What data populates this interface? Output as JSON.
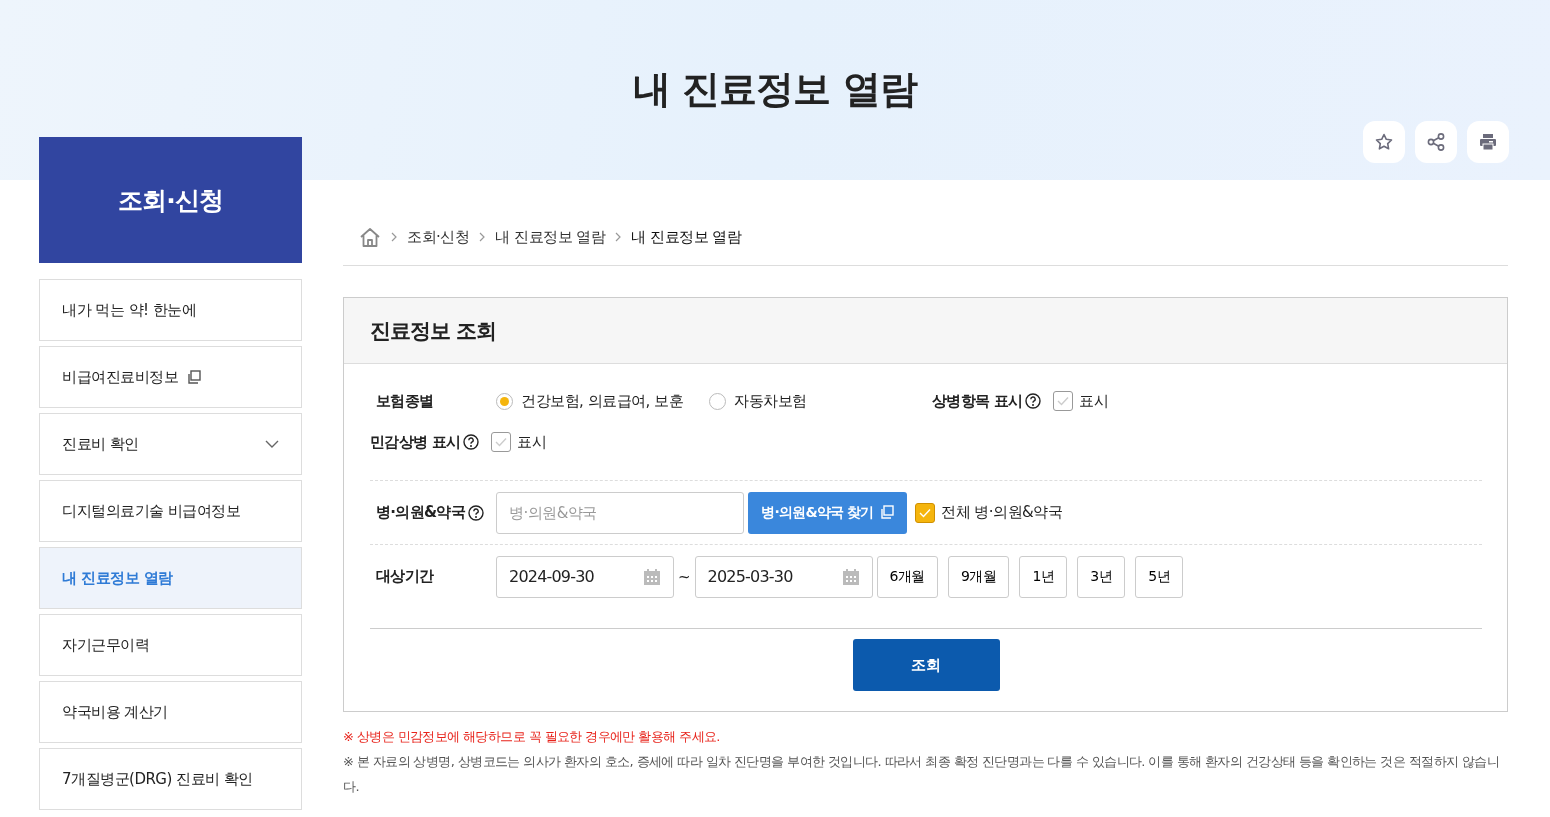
{
  "page_title": "내 진료정보 열람",
  "header_actions": [
    {
      "kind": "star"
    },
    {
      "kind": "share"
    },
    {
      "kind": "print"
    }
  ],
  "sidebar": {
    "title": "조회·신청",
    "items": [
      {
        "label": "내가 먹는 약! 한눈에",
        "kind": "plain",
        "selected": false
      },
      {
        "label": "비급여진료비정보",
        "kind": "external",
        "selected": false
      },
      {
        "label": "진료비 확인",
        "kind": "submenu",
        "selected": false
      },
      {
        "label": "디지털의료기술 비급여정보",
        "kind": "plain",
        "selected": false
      },
      {
        "label": "내 진료정보 열람",
        "kind": "plain",
        "selected": true
      },
      {
        "label": "자기근무이력",
        "kind": "plain",
        "selected": false
      },
      {
        "label": "약국비용 계산기",
        "kind": "plain",
        "selected": false
      },
      {
        "label": "7개질병군(DRG) 진료비 확인",
        "kind": "plain",
        "selected": false
      }
    ]
  },
  "breadcrumb": [
    "조회·신청",
    "내 진료정보 열람",
    "내 진료정보 열람"
  ],
  "panel": {
    "title": "진료정보 조회",
    "insurance": {
      "label": "보험종별",
      "options": [
        {
          "label": "건강보험, 의료급여, 보훈",
          "selected": true
        },
        {
          "label": "자동차보험",
          "selected": false
        }
      ]
    },
    "disease_items": {
      "label": "상병항목 표시",
      "checkbox": "표시",
      "checked": false
    },
    "sensitive": {
      "label": "민감상병 표시",
      "checkbox": "표시",
      "checked": false
    },
    "hospital": {
      "label": "병·의원&약국",
      "placeholder": "병·의원&약국",
      "button": "병·의원&약국 찾기",
      "all_label": "전체 병·의원&약국",
      "all_checked": true
    },
    "period": {
      "label": "대상기간",
      "from": "2024-09-30",
      "separator": "~",
      "to": "2025-03-30",
      "presets": [
        "6개월",
        "9개월",
        "1년",
        "3년",
        "5년"
      ]
    },
    "submit": "조회"
  },
  "notes": [
    {
      "text": "※ 상병은 민감정보에 해당하므로 꼭 필요한 경우에만 활용해 주세요.",
      "kind": "warning"
    },
    {
      "text": "※ 본 자료의 상병명, 상병코드는 의사가 환자의 호소, 증세에 따라 일차 진단명을 부여한 것입니다. 따라서 최종 확정 진단명과는 다를 수 있습니다. 이를 통해 환자의 건강상태 등을 확인하는 것은 적절하지 않습니다.",
      "kind": "info"
    }
  ]
}
